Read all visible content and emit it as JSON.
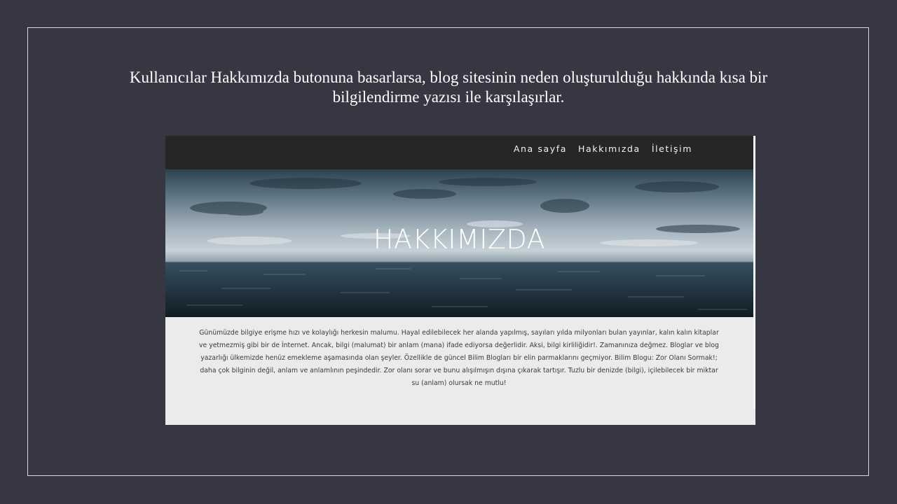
{
  "slide": {
    "caption": "Kullanıcılar Hakkımızda butonuna basarlarsa, blog sitesinin neden oluşturulduğu hakkında kısa bir bilgilendirme yazısı ile karşılaşırlar."
  },
  "website": {
    "nav": {
      "home": "Ana sayfa",
      "about": "Hakkımızda",
      "contact": "İletişim"
    },
    "hero_title": "HAKKIMIZDA",
    "about_text": "Günümüzde bilgiye erişme hızı ve kolaylığı herkesin malumu. Hayal edilebilecek her alanda yapılmış, sayıları yılda milyonları bulan yayınlar, kalın kalın kitaplar ve yetmezmiş gibi bir de İnternet. Ancak, bilgi (malumat) bir anlam (mana) ifade ediyorsa değerlidir. Aksi, bilgi kirliliğidir!. Zamanınıza değmez. Bloglar ve blog yazarlığı ülkemizde henüz emekleme aşamasında olan şeyler. Özellikle de güncel Bilim Blogları bir elin parmaklarını geçmiyor. Bilim Blogu: Zor Olanı Sormak!; daha çok bilginin değil, anlam ve anlamlının peşindedir. Zor olanı sorar ve bunu alışılmışın dışına çıkarak tartışır. Tuzlu bir denizde (bilgi), içilebilecek bir miktar su (anlam) olursak ne mutlu!"
  },
  "colors": {
    "slide_background": "#373643",
    "navbar_background": "#262626",
    "content_background": "#ebebeb"
  }
}
